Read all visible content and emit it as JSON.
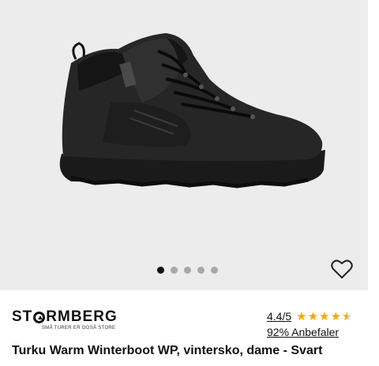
{
  "product": {
    "title": "Turku Warm Winterboot WP, vintersko, dame - Svart",
    "image_icon": "boot-image",
    "carousel": {
      "count": 5,
      "active_index": 0
    }
  },
  "brand": {
    "name_pre": "ST",
    "name_post": "RMBERG",
    "tagline": "SMÅ TURER ER OGSÅ STORE"
  },
  "rating": {
    "value_label": "4.4/5",
    "value": 4.4,
    "max": 5,
    "recommend_label": "92% Anbefaler",
    "star_color": "#f5a800"
  },
  "icons": {
    "favorite": "heart-outline-icon"
  }
}
